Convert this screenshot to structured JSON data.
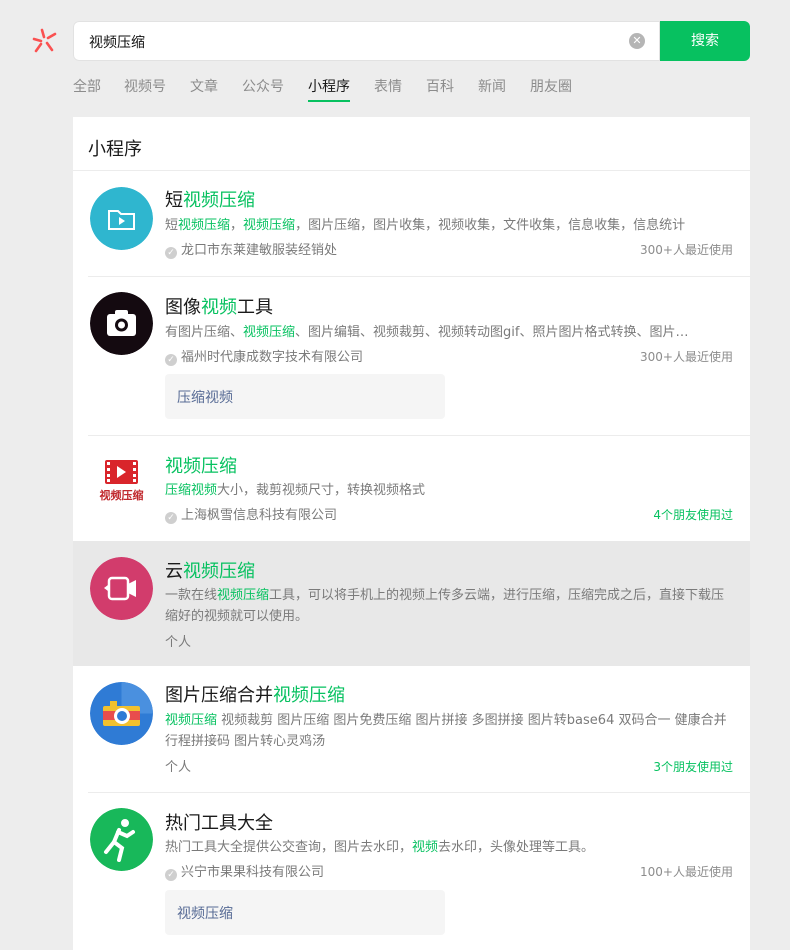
{
  "search": {
    "query": "视频压缩",
    "button": "搜索"
  },
  "tabs": [
    {
      "label": "全部"
    },
    {
      "label": "视频号"
    },
    {
      "label": "文章"
    },
    {
      "label": "公众号"
    },
    {
      "label": "小程序"
    },
    {
      "label": "表情"
    },
    {
      "label": "百科"
    },
    {
      "label": "新闻"
    },
    {
      "label": "朋友圈"
    }
  ],
  "active_tab": "小程序",
  "section": {
    "title": "小程序"
  },
  "colors": {
    "accent": "#07c160",
    "link": "#576b95"
  },
  "results": [
    {
      "title": {
        "pre": "短",
        "hl": "视频压缩",
        "post": ""
      },
      "desc": [
        "短",
        "视频压缩",
        "，",
        "视频压缩",
        "，图片压缩，图片收集，视频收集，文件收集，信息收集，信息统计"
      ],
      "owner": "龙口市东莱建敏服装经销处",
      "usage": "300+人最近使用",
      "icon": "folder-play-icon"
    },
    {
      "title": {
        "pre": "图像",
        "hl": "视频",
        "post": "工具"
      },
      "desc": [
        "有图片压缩、",
        "视频压缩",
        "、图片编辑、视频裁剪、视频转动图gif、照片图片格式转换、图片…"
      ],
      "owner": "福州时代康成数字技术有限公司",
      "usage": "300+人最近使用",
      "service": "压缩视频",
      "icon": "camera-icon"
    },
    {
      "title": {
        "pre": "",
        "hl": "视频压缩",
        "post": ""
      },
      "desc": [
        "",
        "压缩视频",
        "大小，裁剪视频尺寸，转换视频格式"
      ],
      "owner": "上海枫雪信息科技有限公司",
      "usage": "4个朋友使用过",
      "logo_text": "视频压缩",
      "icon": "film-icon"
    },
    {
      "title": {
        "pre": "云",
        "hl": "视频压缩",
        "post": ""
      },
      "desc": [
        "一款在线",
        "视频压缩",
        "工具，可以将手机上的视频上传多云端，进行压缩，压缩完成之后，直接下载压缩好的视频就可以使用。"
      ],
      "owner": "个人",
      "icon": "video-cloud-icon"
    },
    {
      "title": {
        "pre": "图片压缩合并",
        "hl": "视频压缩",
        "post": ""
      },
      "desc": [
        "",
        "视频压缩",
        " 视频裁剪 图片压缩 图片免费压缩 图片拼接 多图拼接 图片转base64 双码合一 健康合并行程拼接码 图片转心灵鸡汤"
      ],
      "owner": "个人",
      "usage": "3个朋友使用过",
      "icon": "photo-camera-icon"
    },
    {
      "title": {
        "pre": "热门工具大全",
        "hl": "",
        "post": ""
      },
      "desc": [
        "热门工具大全提供公交查询，图片去水印，",
        "视频",
        "去水印，头像处理等工具。"
      ],
      "owner": "兴宁市果果科技有限公司",
      "usage": "100+人最近使用",
      "service": "视频压缩",
      "icon": "runner-icon"
    }
  ]
}
